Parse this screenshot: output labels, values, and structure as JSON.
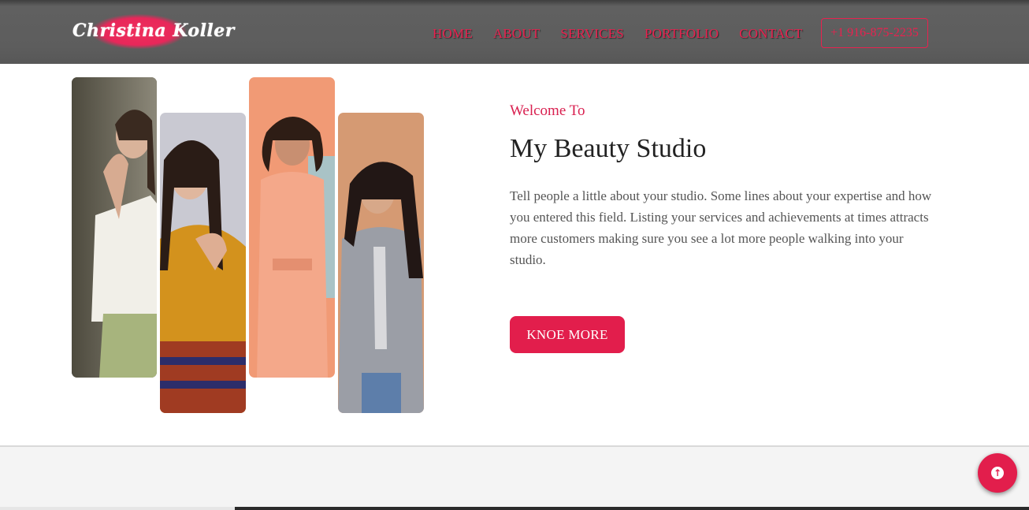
{
  "header": {
    "logo_text": "Christina Koller",
    "nav": [
      "HOME",
      "ABOUT",
      "SERVICES",
      "PORTFOLIO",
      "CONTACT"
    ],
    "phone": "+1 916-875-2235"
  },
  "hero": {
    "welcome": "Welcome To",
    "title": "My Beauty Studio",
    "description": "Tell people a little about your studio. Some lines about your expertise and how you entered this field. Listing your services and achievements at times attracts more customers making sure you see a lot more people walking into your studio.",
    "cta_label": "KNOE MORE"
  },
  "gallery": [
    {
      "name": "model-photo-white-blouse"
    },
    {
      "name": "model-photo-mustard-dress"
    },
    {
      "name": "model-photo-peach-jumpsuit"
    },
    {
      "name": "model-photo-plaid-blazer"
    }
  ],
  "back_to_top": {
    "icon": "arrow-up-icon"
  },
  "colors": {
    "accent": "#e21e4c",
    "header_bg": "#5d5d5d",
    "text_dark": "#222222",
    "text_body": "#555555"
  }
}
